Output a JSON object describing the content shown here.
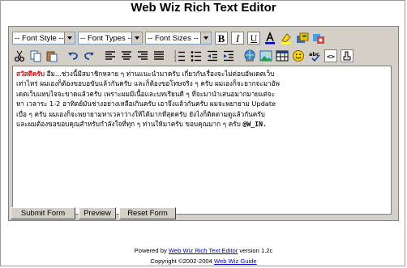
{
  "title": "Web Wiz Rich Text Editor",
  "toolbar": {
    "font_style": "-- Font Style --",
    "font_types": "-- Font Types --",
    "font_sizes": "-- Font Sizes --",
    "row1_icons": [
      "bold-icon",
      "italic-icon",
      "underline-icon",
      "text-color-icon",
      "highlight-icon",
      "save-icon",
      "open-icon"
    ],
    "row2_icons": [
      "cut-icon",
      "copy-icon",
      "paste-icon",
      "undo-icon",
      "redo-icon",
      "align-left-icon",
      "align-center-icon",
      "align-right-icon",
      "justify-icon",
      "ordered-list-icon",
      "unordered-list-icon",
      "outdent-icon",
      "indent-icon",
      "link-icon",
      "image-icon",
      "table-icon",
      "emoticon-icon",
      "spellcheck-icon",
      "source-icon",
      "clean-icon"
    ]
  },
  "editor": {
    "greeting": "สวัสดีครับ",
    "line1_rest": " อืม...ช่วงนี้มีสมาชิกหลาย ๆ ท่านแนะนำมาครับ เกี่ยวกับเรื่องจะไม่ต่อบอัพเดตเว็บ",
    "line2": "เท่าไหร่ ผมเองก็ต้องขอบอขับแล้วกันครับ และก็ต้องขอโทษจริง ๆ ครับ ผมเองก็จะยากจะมาอัพ",
    "line3": "เดตเว็บแทบไจจะขาดแล้วครับ เพราะผมมีเนื้อและบทเรียนดี ๆ ที่จะมานำเสนอมากมายแต่จะ",
    "line4": "หา เวลาระ 1-2 อาทิตย์มันช่างอย่างเหลือเกินครับ เอาจึงแล้วกันครับ ผมจะพยายาม Update",
    "line5": "เบื่อ ๆ ครับ ผมเองก็จะพยายามหาเวลาว่างให้ได้มากที่สุดครับ ยังไงก็ติดตามดูแล้วกันครับ",
    "line6": "และผมต้องขอขอบคุณสำหรับกำลังใจที่ทุก ๆ ท่านให้มาครับ ขอบคุณมาก ๆ ครับ ",
    "signature": "@W_IN."
  },
  "buttons": {
    "submit": "Submit Form",
    "preview": "Preview",
    "reset": "Reset Form"
  },
  "footer": {
    "powered_prefix": "Powered by ",
    "powered_link": "Web Wiz Rich Text Editor",
    "powered_suffix": " version 1.2c",
    "copyright_prefix": "Copyright ©2002-2004 ",
    "copyright_link": "Web Wiz Guide"
  }
}
